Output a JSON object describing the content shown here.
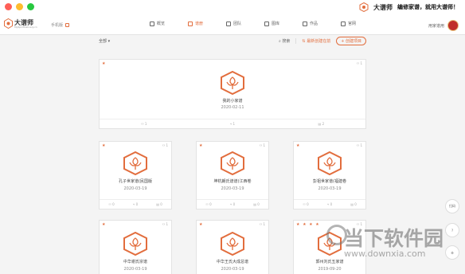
{
  "topbar": {
    "brand_name": "大谱师",
    "slogan": "编修家谱，就用大谱师！"
  },
  "nav": {
    "logo_name": "大谱师",
    "logo_sub": "MySpiritDelivery.cn",
    "phone_label": "手机版",
    "tabs": [
      {
        "label": "概览"
      },
      {
        "label": "谱册"
      },
      {
        "label": "团队"
      },
      {
        "label": "图库"
      },
      {
        "label": "作品"
      },
      {
        "label": "官网"
      }
    ],
    "user_label": "用家谱用"
  },
  "toolbar": {
    "filter_label": "全部",
    "search_label": "搜索",
    "sort_label": "最新创建在前",
    "create_label": "+ 创建项目"
  },
  "cards": [
    {
      "flag": "★",
      "members": "1",
      "name": "我的小家谱",
      "date": "2020-02-11",
      "stats": [
        "1",
        "1",
        "2"
      ]
    },
    {
      "flag": "★",
      "members": "1",
      "name": "孔子世家谱(民国版",
      "date": "2020-03-19",
      "stats": [
        "0",
        "0",
        "0"
      ]
    },
    {
      "flag": "★",
      "members": "1",
      "name": "坤杭朗氏谱谱(江西卷",
      "date": "2020-03-19",
      "stats": [
        "0",
        "0",
        "0"
      ]
    },
    {
      "flag": "★",
      "members": "1",
      "name": "彭祖世家谱(福建卷",
      "date": "2020-03-19",
      "stats": [
        "0",
        "0",
        "0"
      ]
    },
    {
      "flag": "★",
      "members": "1",
      "name": "中华谢氏宗谱",
      "date": "2020-03-19",
      "stats": [],
      "name_display": "中华谢氏宗谱"
    },
    {
      "flag": "★",
      "members": "1",
      "name": "中华王氏大成总谱",
      "date": "2020-03-19",
      "stats": []
    },
    {
      "flag": "★ ★ ★ ★",
      "members": "1",
      "name": "郭州刘氏五家谱",
      "date": "2019-09-20",
      "stats": []
    }
  ],
  "floats": [
    {
      "label": "扫码"
    },
    {
      "label": ""
    },
    {
      "label": ""
    }
  ],
  "watermark": {
    "cn": "当下软件园",
    "url": "www.downxia.com"
  },
  "colors": {
    "accent": "#e26d3d",
    "background": "#f4f4f4"
  }
}
